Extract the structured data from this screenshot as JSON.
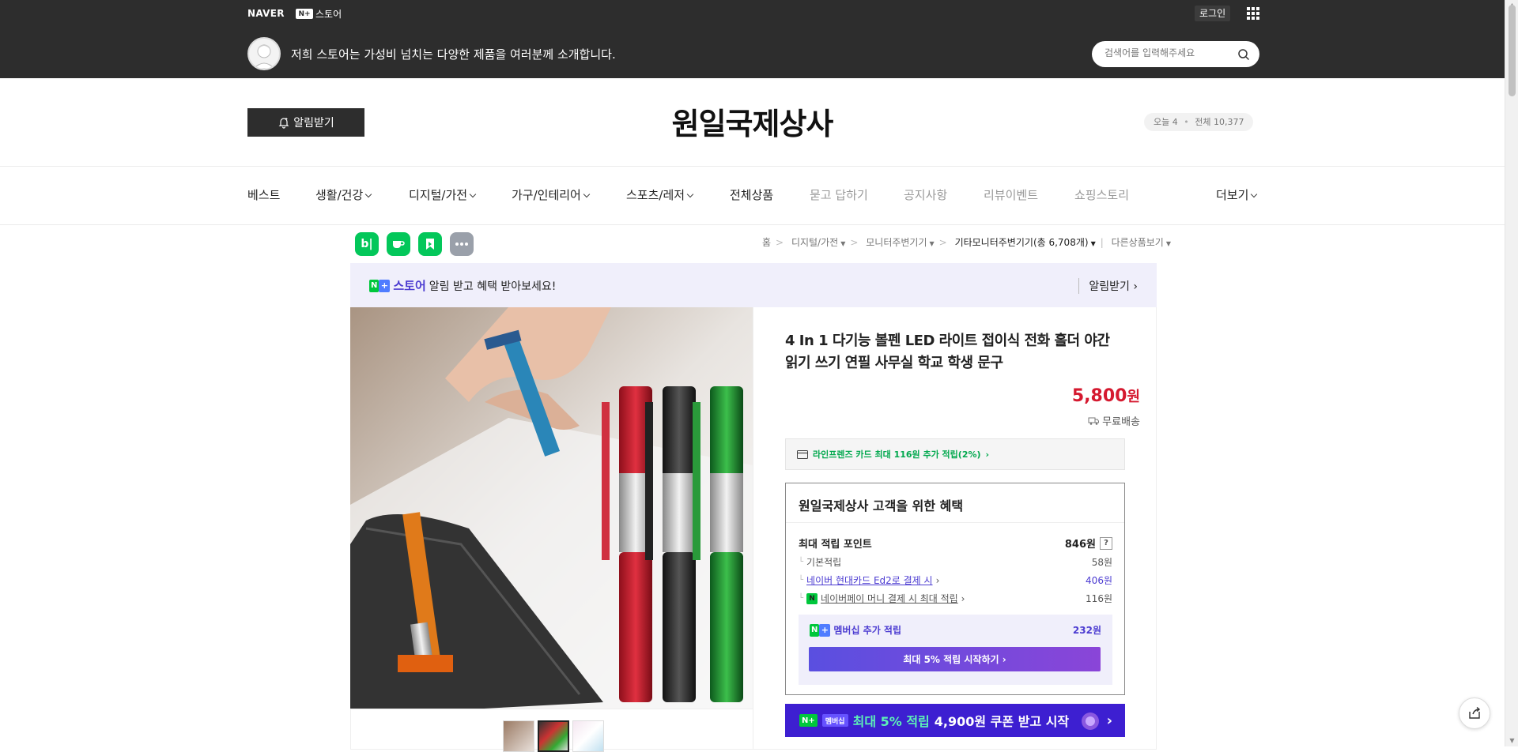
{
  "topbar": {
    "naver_logo": "NAVER",
    "nplus_badge": "N+",
    "store_label": "스토어",
    "login": "로그인",
    "tagline": "저희 스토어는 가성비 넘치는 다양한 제품을 여러분께 소개합니다.",
    "search_placeholder": "검색어를 입력해주세요"
  },
  "store": {
    "alarm_button": "알림받기",
    "title": "원일국제상사",
    "today_label": "오늘 4",
    "total_label": "전체 10,377"
  },
  "nav": {
    "items": [
      {
        "label": "베스트",
        "dropdown": false,
        "muted": false
      },
      {
        "label": "생활/건강",
        "dropdown": true,
        "muted": false
      },
      {
        "label": "디지털/가전",
        "dropdown": true,
        "muted": false
      },
      {
        "label": "가구/인테리어",
        "dropdown": true,
        "muted": false
      },
      {
        "label": "스포츠/레저",
        "dropdown": true,
        "muted": false
      },
      {
        "label": "전체상품",
        "dropdown": false,
        "muted": false
      },
      {
        "label": "묻고 답하기",
        "dropdown": false,
        "muted": true
      },
      {
        "label": "공지사항",
        "dropdown": false,
        "muted": true
      },
      {
        "label": "리뷰이벤트",
        "dropdown": false,
        "muted": true
      },
      {
        "label": "쇼핑스토리",
        "dropdown": false,
        "muted": true
      }
    ],
    "more": "더보기"
  },
  "social_icons": [
    {
      "name": "blog-icon",
      "glyph": "b|",
      "color": "#03c75a"
    },
    {
      "name": "cafe-icon",
      "glyph": "☕",
      "color": "#03c75a"
    },
    {
      "name": "bookmark-icon",
      "glyph": "◢",
      "color": "#03c75a"
    },
    {
      "name": "more-icon",
      "glyph": "•••",
      "color": "#9aa0aa"
    }
  ],
  "breadcrumb": {
    "home": "홈",
    "cat1": "디지털/가전",
    "cat2": "모니터주변기기",
    "cat3": "기타모니터주변기기",
    "count": "(총 6,708개)",
    "other": "다른상품보기"
  },
  "promo": {
    "badge": "N+",
    "store_word": "스토어",
    "message": "알림 받고 혜택 받아보세요!",
    "action": "알림받기"
  },
  "product": {
    "name": "4 In 1 다기능 볼펜 LED 라이트 접이식 전화 홀더 야간 읽기 쓰기 연필 사무실 학교 학생 문구",
    "price": "5,800",
    "price_unit": "원",
    "shipping": "무료배송",
    "card_benefit": "라인프렌즈 카드 최대 116원 추가 적립(2%)"
  },
  "benefits": {
    "title": "원일국제상사 고객을 위한 혜택",
    "max_points_label": "최대 적립 포인트",
    "max_points_value": "846원",
    "question": "?",
    "rows": [
      {
        "label": "기본적립",
        "value": "58원"
      },
      {
        "label": "네이버 현대카드 Ed2로 결제 시",
        "value": "406원"
      },
      {
        "label": "네이버페이 머니 결제 시 최대 적립",
        "value": "116원"
      }
    ],
    "member_label": "멤버십 추가 적립",
    "member_value": "232원",
    "member_button": "최대 5% 적립 시작하기"
  },
  "membership_banner": {
    "badge": "N+",
    "tag": "멤버십",
    "highlight": "최대 5% 적립",
    "text": "4,900원 쿠폰 받고 시작"
  },
  "colors": {
    "dark_header": "#2d2d2d",
    "price_red": "#d5192f",
    "naver_green": "#03c75a",
    "purple": "#4b3bd1"
  }
}
